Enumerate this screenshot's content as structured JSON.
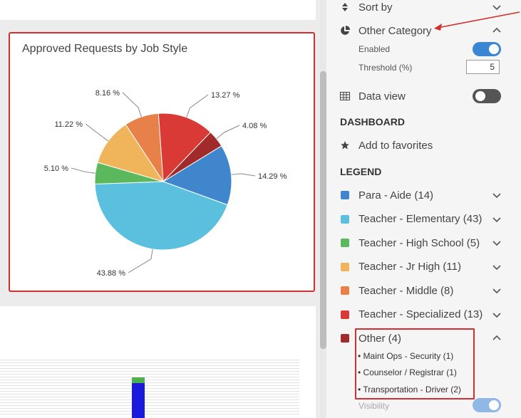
{
  "chart_data": {
    "type": "pie",
    "title": "Approved Requests by Job Style",
    "series": [
      {
        "name": "Para - Aide",
        "value": 14.29,
        "label": "14.29 %",
        "color": "#3f86cc"
      },
      {
        "name": "Teacher - Elementary",
        "value": 43.88,
        "label": "43.88 %",
        "color": "#5bc0de"
      },
      {
        "name": "Teacher - High School",
        "value": 5.1,
        "label": "5.10 %",
        "color": "#5cb85c"
      },
      {
        "name": "Teacher - Jr High",
        "value": 11.22,
        "label": "11.22 %",
        "color": "#f0b55a"
      },
      {
        "name": "Teacher - Middle",
        "value": 8.16,
        "label": "8.16 %",
        "color": "#e8804a"
      },
      {
        "name": "Teacher - Specialized",
        "value": 13.27,
        "label": "13.27 %",
        "color": "#d93a35"
      },
      {
        "name": "Other",
        "value": 4.08,
        "label": "4.08 %",
        "color": "#a12a2a"
      }
    ]
  },
  "panel": {
    "sort_by": "Sort by",
    "other_category": "Other Category",
    "enabled_label": "Enabled",
    "threshold_label": "Threshold (%)",
    "threshold_value": "5",
    "data_view": "Data view",
    "dashboard_heading": "DASHBOARD",
    "add_favorites": "Add to favorites",
    "legend_heading": "LEGEND",
    "legend": [
      {
        "label": "Para - Aide (14)",
        "color": "#3f86cc"
      },
      {
        "label": "Teacher - Elementary (43)",
        "color": "#5bc0de"
      },
      {
        "label": "Teacher - High School (5)",
        "color": "#5cb85c"
      },
      {
        "label": "Teacher - Jr High (11)",
        "color": "#f0b55a"
      },
      {
        "label": "Teacher - Middle (8)",
        "color": "#e8804a"
      },
      {
        "label": "Teacher - Specialized (13)",
        "color": "#d93a35"
      },
      {
        "label": "Other (4)",
        "color": "#a12a2a"
      }
    ],
    "other_items": [
      "Maint Ops - Security (1)",
      "Counselor / Registrar (1)",
      "Transportation - Driver (2)"
    ],
    "visibility": "Visibility"
  },
  "colors": {
    "toggle_on": "#3a85d4",
    "toggle_off": "#555555",
    "highlight": "#d32f2f"
  }
}
